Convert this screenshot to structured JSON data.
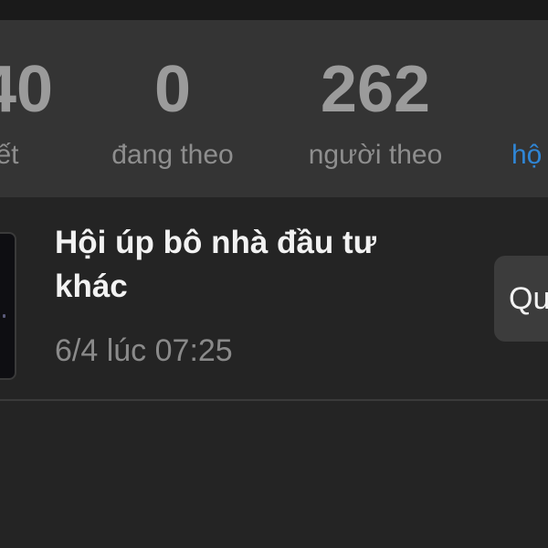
{
  "stats": [
    {
      "value": "40",
      "label": "ết"
    },
    {
      "value": "0",
      "label": "đang theo"
    },
    {
      "value": "262",
      "label": "người theo"
    },
    {
      "value": "",
      "label": "hộ"
    }
  ],
  "group": {
    "title": "Hội úp bô nhà đầu tư khác",
    "time": "6/4 lúc 07:25",
    "action_label": "Qu"
  },
  "colors": {
    "background": "#242424",
    "stats_background": "#343434",
    "link": "#2f86d6"
  }
}
